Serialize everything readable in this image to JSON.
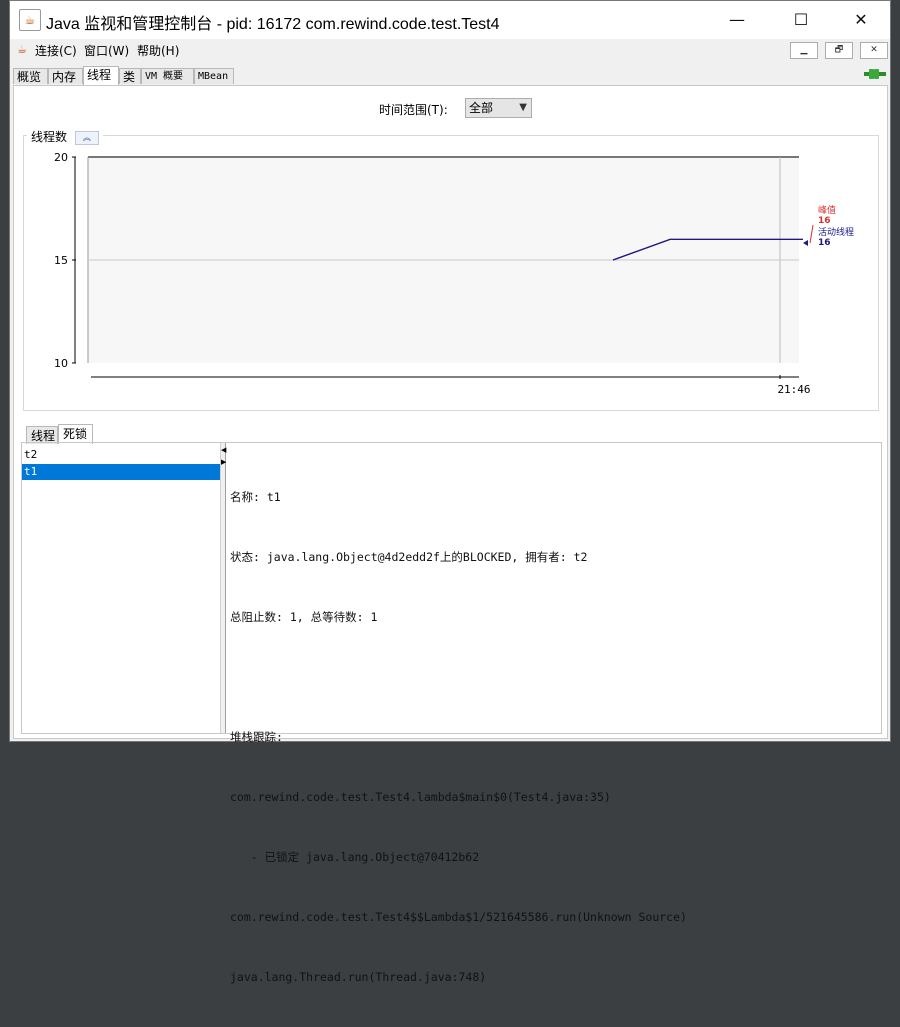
{
  "window": {
    "title": "Java 监视和管理控制台 - pid: 16172 com.rewind.code.test.Test4",
    "controls": {
      "minimize": "—",
      "maximize": "☐",
      "close": "✕"
    }
  },
  "menubar": {
    "items": [
      "连接(C)",
      "窗口(W)",
      "帮助(H)"
    ],
    "mdi_controls": [
      "▁",
      "🗗",
      "✕"
    ]
  },
  "tabs": [
    {
      "label": "概览"
    },
    {
      "label": "内存"
    },
    {
      "label": "线程",
      "active": true
    },
    {
      "label": "类"
    },
    {
      "label": "VM 概要"
    },
    {
      "label": "MBean"
    }
  ],
  "time_range": {
    "label": "时间范围(T):",
    "selected": "全部"
  },
  "chart_panel": {
    "label": "线程数",
    "collapse_icon": "double-chevron-up-icon"
  },
  "chart_data": {
    "type": "line",
    "title": "",
    "xlabel": "",
    "ylabel": "",
    "ylim": [
      10,
      20
    ],
    "yticks": [
      "20",
      "15",
      "10"
    ],
    "xticks": [
      "21:46"
    ],
    "grid": true,
    "series": [
      {
        "name": "峰值",
        "color": "#d83030",
        "current": "16",
        "points": [
          [
            0.0,
            15
          ],
          [
            0.3,
            16
          ],
          [
            1.0,
            16
          ]
        ]
      },
      {
        "name": "活动线程",
        "color": "#1a1a8c",
        "current": "16",
        "points": [
          [
            0.0,
            15
          ],
          [
            0.3,
            16
          ],
          [
            1.0,
            16
          ]
        ]
      }
    ],
    "legend": "right"
  },
  "lower_tabs": [
    {
      "label": "线程"
    },
    {
      "label": "死锁",
      "active": true
    }
  ],
  "threads": [
    {
      "name": "t2"
    },
    {
      "name": "t1",
      "selected": true
    }
  ],
  "details": {
    "name_line": "名称: t1",
    "state_line": "状态: java.lang.Object@4d2edd2f上的BLOCKED, 拥有者: t2",
    "counts_line": "总阻止数: 1, 总等待数: 1",
    "blank": "",
    "stack_header": "堆栈跟踪:",
    "stack": [
      "com.rewind.code.test.Test4.lambda$main$0(Test4.java:35)",
      "   - 已锁定 java.lang.Object@70412b62",
      "com.rewind.code.test.Test4$$Lambda$1/521645586.run(Unknown Source)",
      "java.lang.Thread.run(Thread.java:748)"
    ]
  },
  "colors": {
    "peak": "#d83030",
    "live": "#1a1a8c",
    "selection": "#0078d7"
  }
}
